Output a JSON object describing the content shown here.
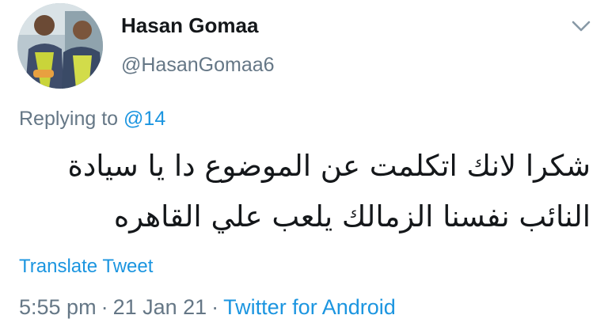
{
  "author": {
    "display_name": "Hasan Gomaa",
    "handle": "@HasanGomaa6"
  },
  "reply": {
    "prefix": "Replying to",
    "mention": "@14"
  },
  "tweet": {
    "lines": [
      "شكرا لانك اتكلمت عن الموضوع دا يا سيادة",
      "النائب نفسنا الزمالك يلعب علي القاهره"
    ]
  },
  "actions": {
    "translate": "Translate Tweet"
  },
  "meta": {
    "time": "5:55 pm",
    "separator": "·",
    "date": "21 Jan 21",
    "source": "Twitter for Android"
  },
  "icons": {
    "menu": "chevron-down-icon",
    "avatar": "avatar-photo"
  },
  "colors": {
    "link": "#1b95e0",
    "secondary_text": "#657786",
    "primary_text": "#14171a"
  }
}
